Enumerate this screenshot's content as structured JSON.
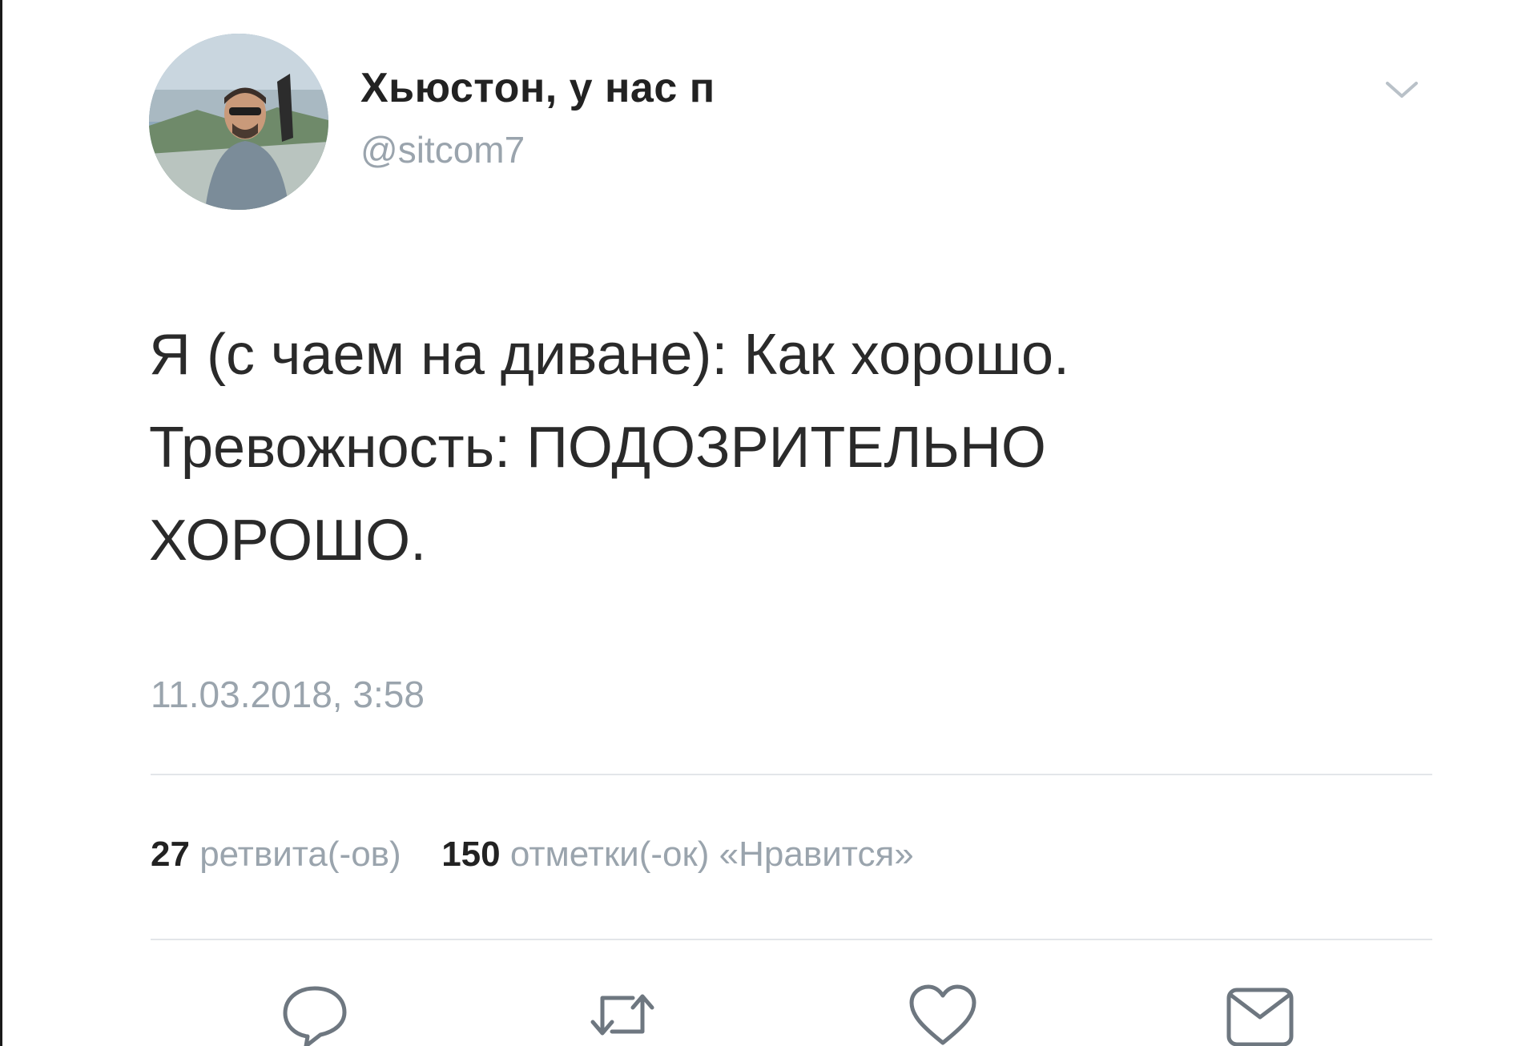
{
  "tweet": {
    "display_name": "Хьюстон, у нас п",
    "handle": "@sitcom7",
    "text_lines": [
      "Я (с чаем на диване): Как хорошо.",
      "Тревожность: ПОДОЗРИТЕЛЬНО",
      "ХОРОШО."
    ],
    "timestamp": "11.03.2018, 3:58"
  },
  "stats": {
    "retweets_count": "27",
    "retweets_label": "ретвита(-ов)",
    "likes_count": "150",
    "likes_label": "отметки(-ок) «Нравится»"
  },
  "icons": {
    "menu": "chevron-down-icon",
    "reply": "reply-icon",
    "retweet": "retweet-icon",
    "like": "heart-icon",
    "message": "envelope-icon"
  },
  "colors": {
    "text": "#2a2a2a",
    "secondary": "#9aa4ad",
    "divider": "#e3e6e9"
  }
}
